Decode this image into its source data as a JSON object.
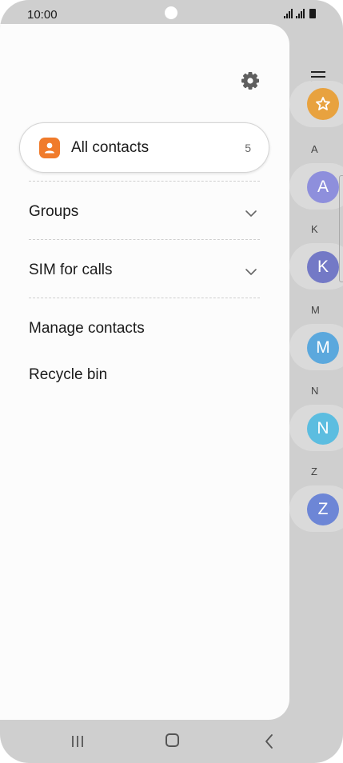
{
  "status_bar": {
    "time": "10:00"
  },
  "drawer": {
    "all_contacts": {
      "label": "All contacts",
      "count": "5"
    },
    "menu": [
      {
        "label": "Groups",
        "expandable": true
      },
      {
        "label": "SIM for calls",
        "expandable": true
      },
      {
        "label": "Manage contacts",
        "expandable": false
      },
      {
        "label": "Recycle bin",
        "expandable": false
      }
    ]
  },
  "background_list": {
    "index_letters": [
      "A",
      "K",
      "M",
      "N",
      "Z"
    ],
    "avatars": [
      {
        "letter": "A",
        "color": "#8e8fdc"
      },
      {
        "letter": "K",
        "color": "#7379c6"
      },
      {
        "letter": "M",
        "color": "#5ba8dd"
      },
      {
        "letter": "N",
        "color": "#5cbde0"
      },
      {
        "letter": "Z",
        "color": "#6d86d6"
      }
    ],
    "favorite_color": "#e8a23f"
  },
  "colors": {
    "accent": "#f07b2b",
    "drawer_bg": "#fcfcfc",
    "screen_bg": "#cfcfcf"
  }
}
